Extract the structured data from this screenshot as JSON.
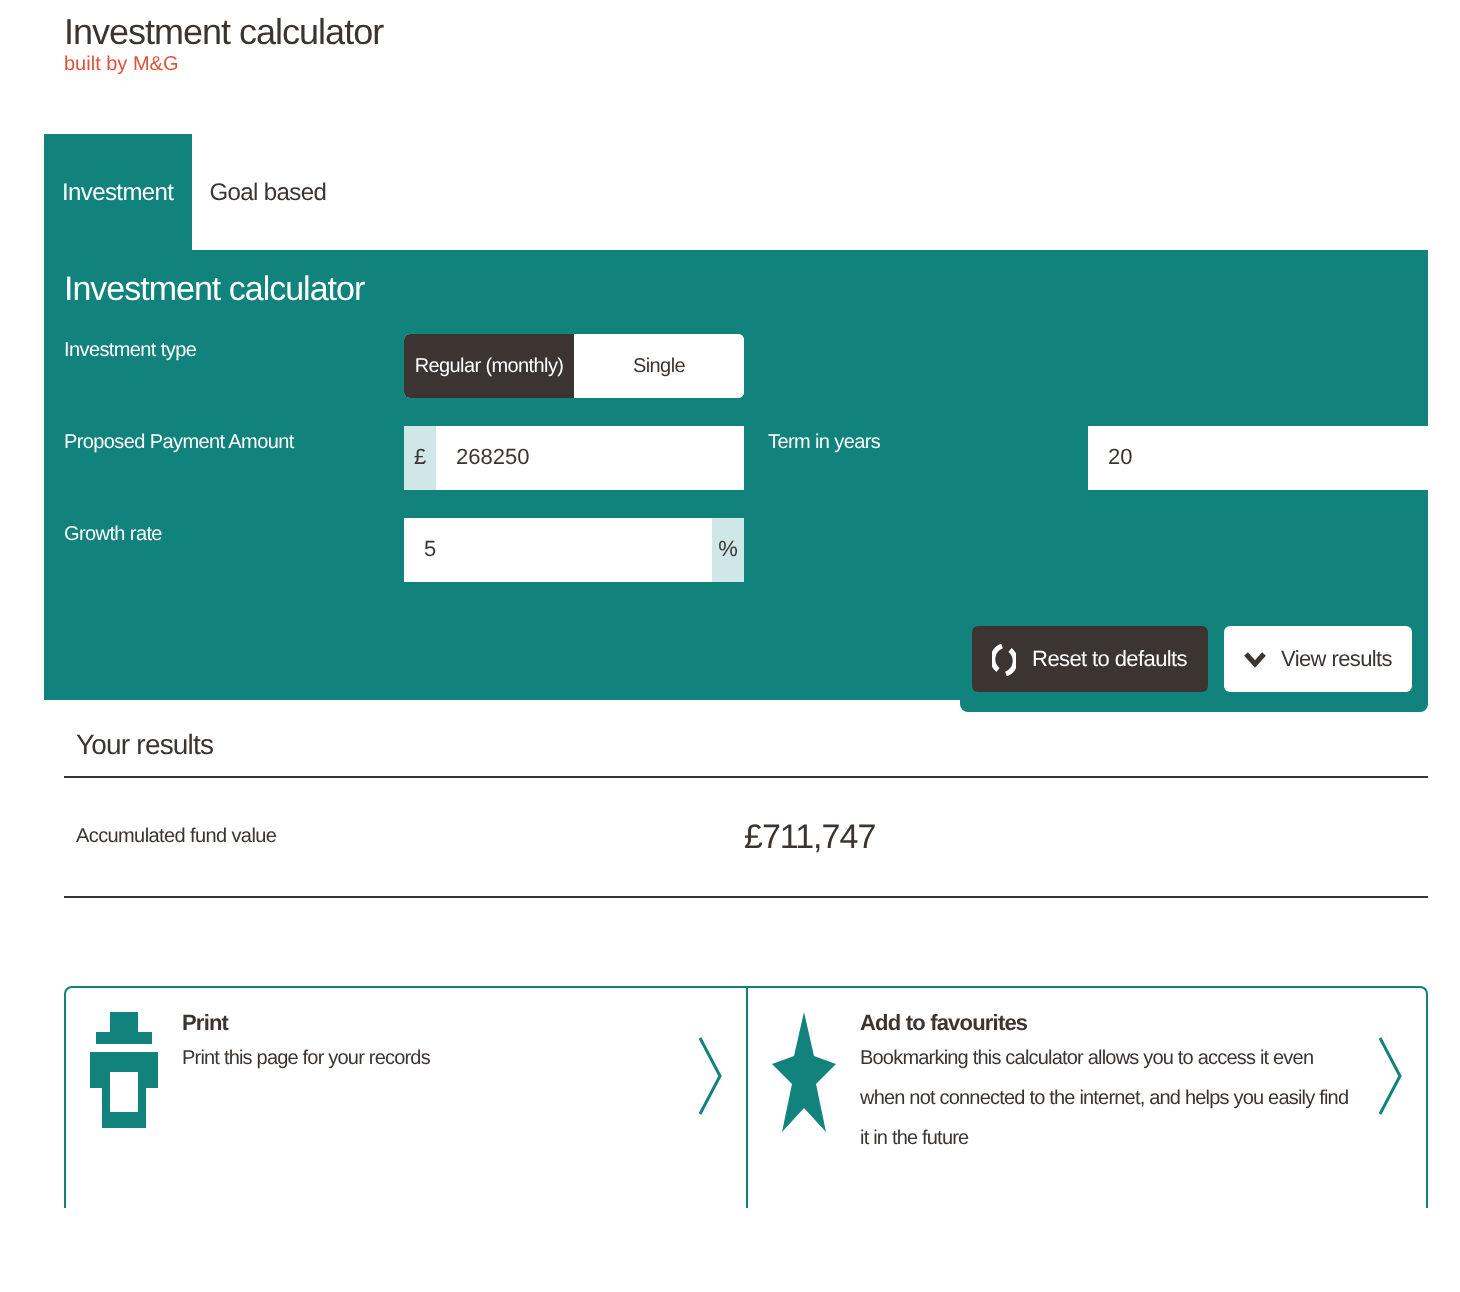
{
  "header": {
    "title": "Investment calculator",
    "subtitle": "built by M&G"
  },
  "tabs": [
    {
      "label": "Investment",
      "selected": true
    },
    {
      "label": "Goal based",
      "selected": false
    }
  ],
  "panel": {
    "title": "Investment calculator",
    "investment_type": {
      "label": "Investment type",
      "options": [
        {
          "label": "Regular (monthly)",
          "selected": true
        },
        {
          "label": "Single",
          "selected": false
        }
      ]
    },
    "payment": {
      "label": "Proposed Payment Amount",
      "prefix": "£",
      "value": "268250"
    },
    "term": {
      "label": "Term in years",
      "value": "20"
    },
    "growth": {
      "label": "Growth rate",
      "value": "5",
      "suffix": "%"
    },
    "buttons": [
      {
        "kind": "reset",
        "label": "Reset to defaults"
      },
      {
        "kind": "view",
        "label": "View results"
      }
    ]
  },
  "results": {
    "title": "Your results",
    "rows": [
      {
        "label": "Accumulated fund value",
        "value": "£711,747"
      }
    ]
  },
  "cards": [
    {
      "kind": "print",
      "title": "Print",
      "text": "Print this page for your records"
    },
    {
      "kind": "favourite",
      "title": "Add to favourites",
      "text": "Bookmarking this calculator allows you to access it even when not connected to the internet, and helps you easily find it in the future"
    }
  ]
}
